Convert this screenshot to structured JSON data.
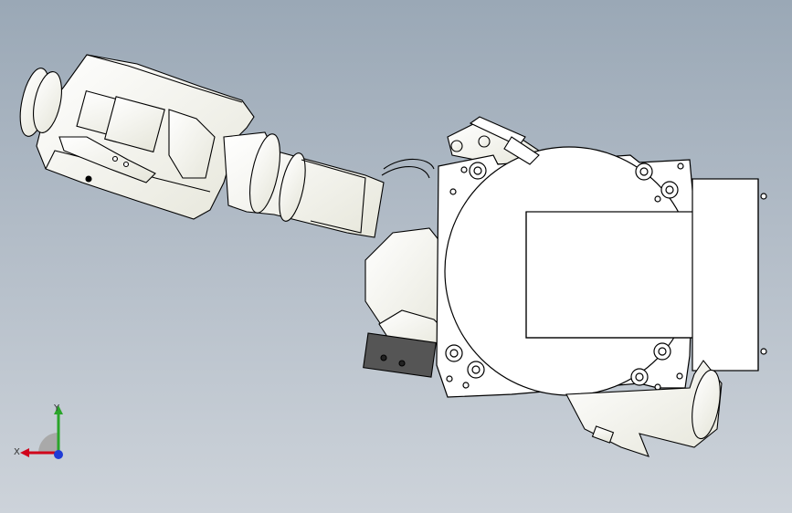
{
  "viewport": {
    "model": "robot-arm-assembly",
    "background_top": "#9aa8b6",
    "background_bottom": "#cdd3da",
    "part_fill": "#ffffff",
    "part_shade": "#e9e9de",
    "edge_color": "#000000"
  },
  "triad": {
    "x_label": "X",
    "y_label": "Y",
    "x_color": "#d0021b",
    "y_color": "#2aa52a",
    "z_color": "#1f3bd6"
  }
}
